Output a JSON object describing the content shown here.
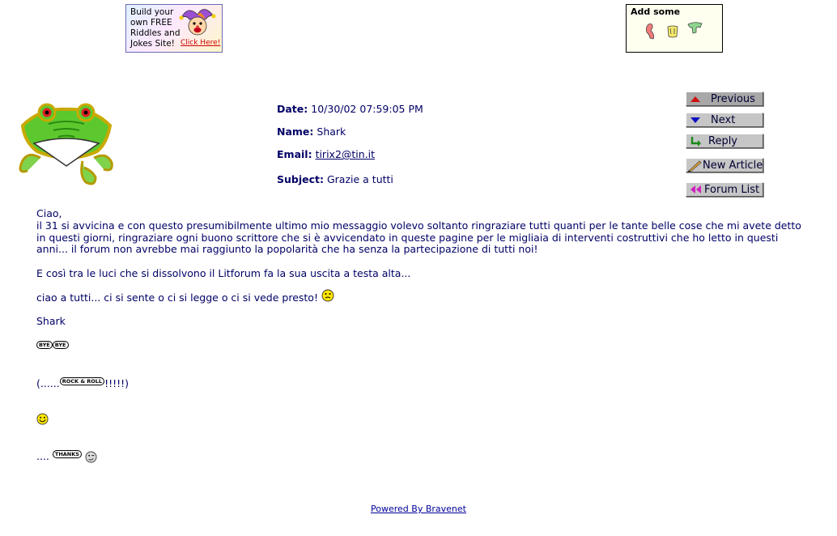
{
  "ad": {
    "line1": "Build your",
    "line2": "own FREE",
    "line3": "Riddles and",
    "line4": "Jokes Site!",
    "click": "Click Here!"
  },
  "add_box": {
    "title": "Add some"
  },
  "header": {
    "date_label": "Date:",
    "date_value": "10/30/02 07:59:05 PM",
    "name_label": "Name:",
    "name_value": "Shark",
    "email_label": "Email:",
    "email_value": "tirix2@tin.it",
    "subject_label": "Subject:",
    "subject_value": "Grazie a tutti"
  },
  "nav": {
    "previous": "Previous",
    "next": "Next",
    "reply": "Reply",
    "new_article": "New Article",
    "forum_list": "Forum List"
  },
  "message": {
    "p1": "Ciao,",
    "p2": "il 31 si avvicina e con questo presumibilmente ultimo mio messaggio volevo soltanto ringraziare tutti quanti per le tante belle cose che mi avete detto in questi giorni, ringraziare ogni buono scrittore che si è avvicendato in queste pagine per le migliaia di interventi costruttivi che ho letto in questi anni... il forum non avrebbe mai raggiunto la popolarità che ha senza la partecipazione di tutti noi!",
    "p3": "E così tra le luci che si dissolvono il Litforum fa la sua uscita a testa alta...",
    "p4": "ciao a tutti... ci si sente o ci si legge o ci si vede presto!",
    "p5": "Shark",
    "bye1": "BYE",
    "bye2": "BYE",
    "p6_prefix": "(......",
    "rock": "ROCK & ROLL",
    "p6_suffix": "!!!!!)",
    "p8_prefix": "....",
    "thanks": "THANKS"
  },
  "footer": {
    "powered": "Powered By Bravenet"
  }
}
